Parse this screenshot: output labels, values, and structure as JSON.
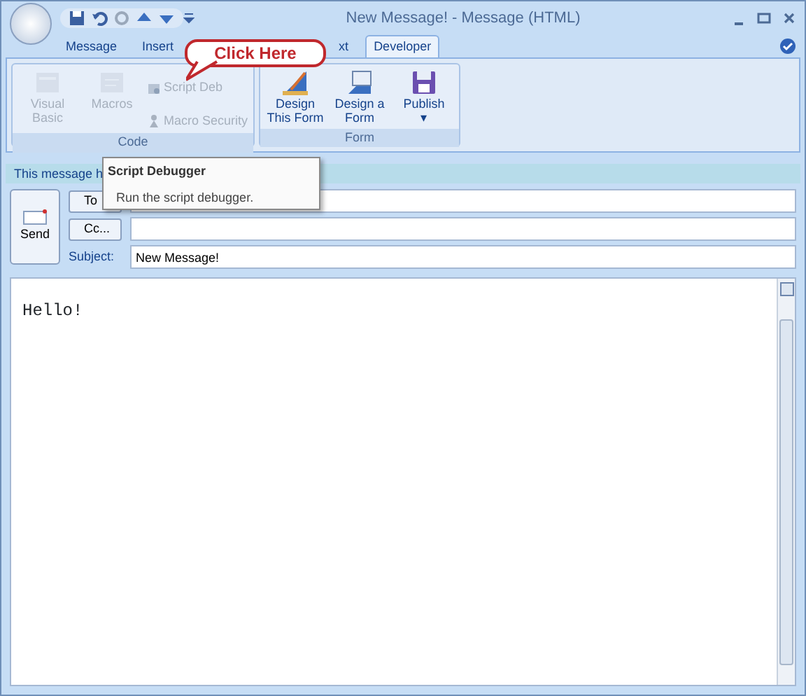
{
  "window": {
    "title": "New Message! - Message (HTML)"
  },
  "tabs": [
    {
      "label": "Message",
      "selected": false
    },
    {
      "label": "Insert",
      "selected": false
    },
    {
      "label": "xt",
      "selected": false
    },
    {
      "label": "Developer",
      "selected": true
    }
  ],
  "ribbon_groups": [
    {
      "label": "Code",
      "items": [
        {
          "kind": "large",
          "label": "Visual Basic",
          "disabled": true
        },
        {
          "kind": "large",
          "label": "Macros",
          "disabled": true
        },
        {
          "kind": "small",
          "label": "Script Deb",
          "disabled": true
        },
        {
          "kind": "small",
          "label": "Macro Security",
          "disabled": true
        }
      ]
    },
    {
      "label": "Form",
      "items": [
        {
          "kind": "large",
          "label": "Design This Form",
          "disabled": false
        },
        {
          "kind": "large",
          "label": "Design a Form",
          "disabled": false
        },
        {
          "kind": "large",
          "label": "Publish",
          "disabled": false,
          "caret": "▾"
        }
      ]
    }
  ],
  "callout": {
    "text": "Click Here"
  },
  "info_bar": {
    "text": "This message h"
  },
  "tooltip": {
    "title": "Script Debugger",
    "text": "Run the script debugger."
  },
  "send_button": {
    "label": "Send"
  },
  "fields": [
    {
      "kind": "button",
      "label": "To"
    },
    {
      "kind": "button",
      "label": "Cc..."
    },
    {
      "kind": "label",
      "label": "Subject:",
      "value": "New Message!"
    }
  ],
  "body": {
    "text": "Hello!"
  }
}
